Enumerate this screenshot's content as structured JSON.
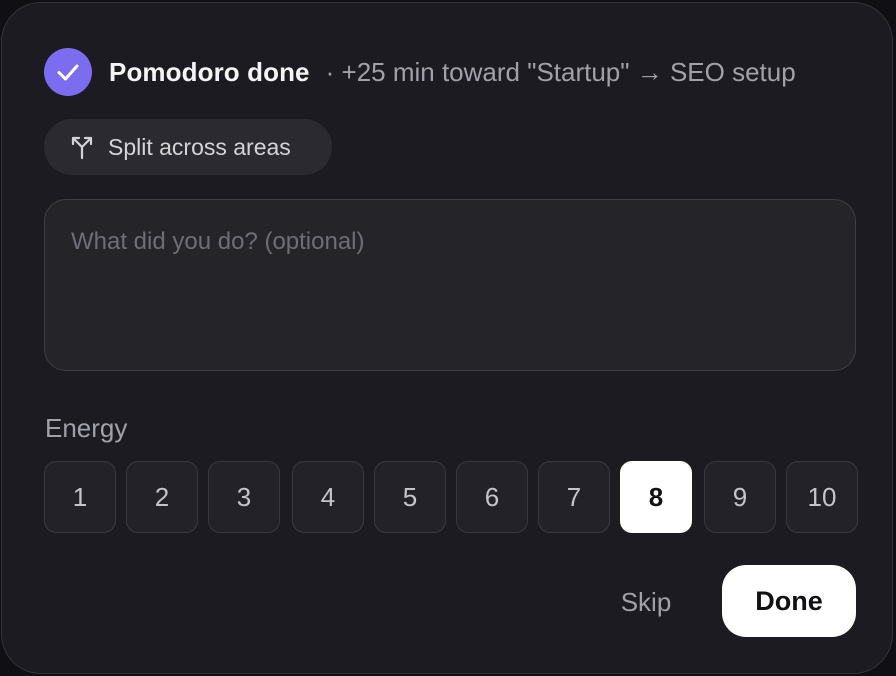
{
  "header": {
    "title": "Pomodoro done",
    "subtitle": "· +25 min toward \"Startup\" → SEO setup",
    "check_icon": "check-icon",
    "accent_color": "#7c6df0"
  },
  "split": {
    "label": "Split across areas",
    "icon": "split-icon"
  },
  "notes": {
    "placeholder": "What did you do? (optional)",
    "value": ""
  },
  "energy": {
    "label": "Energy",
    "options": [
      "1",
      "2",
      "3",
      "4",
      "5",
      "6",
      "7",
      "8",
      "9",
      "10"
    ],
    "selected": "8"
  },
  "actions": {
    "skip_label": "Skip",
    "done_label": "Done"
  }
}
